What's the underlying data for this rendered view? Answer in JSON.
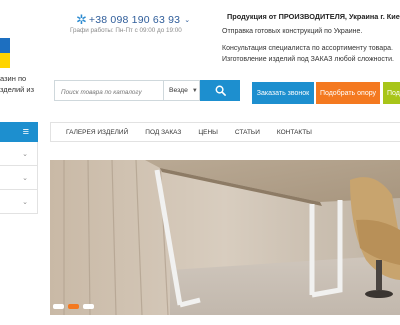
{
  "header": {
    "logo_text": [
      "азин по",
      "зделий из"
    ],
    "phone": "+38 098 190 63 93",
    "hours": "Графи работы: Пн-Пт с 09:00 до 19:00",
    "producer": "Продукция от ПРОИЗВОДИТЕЛЯ, Украина г. Киев",
    "info": [
      "Отправка готовых конструкций по Украине.",
      "Консультация специалиста по ассортименту товара.",
      "Изготовление изделий под ЗАКАЗ любой сложности."
    ]
  },
  "search": {
    "placeholder": "Поиск товара по каталогу",
    "scope": "Везде"
  },
  "buttons": {
    "call": "Заказать звонок",
    "pick": "Подобрать опору",
    "more": "Под"
  },
  "nav": {
    "items": [
      "ГАЛЕРЕЯ ИЗДЕЛИЙ",
      "ПОД ЗАКАЗ",
      "ЦЕНЫ",
      "СТАТЬИ",
      "КОНТАКТЫ"
    ]
  },
  "slider": {
    "dots": 3,
    "active_index": 1
  },
  "colors": {
    "brand_blue": "#1d8fcf",
    "orange": "#f47920",
    "green": "#a8c519"
  },
  "icons": {
    "menu": "hamburger-icon",
    "search": "search-icon",
    "sidebar": "chevron-down-icon",
    "phone": "snowflake-icon"
  }
}
